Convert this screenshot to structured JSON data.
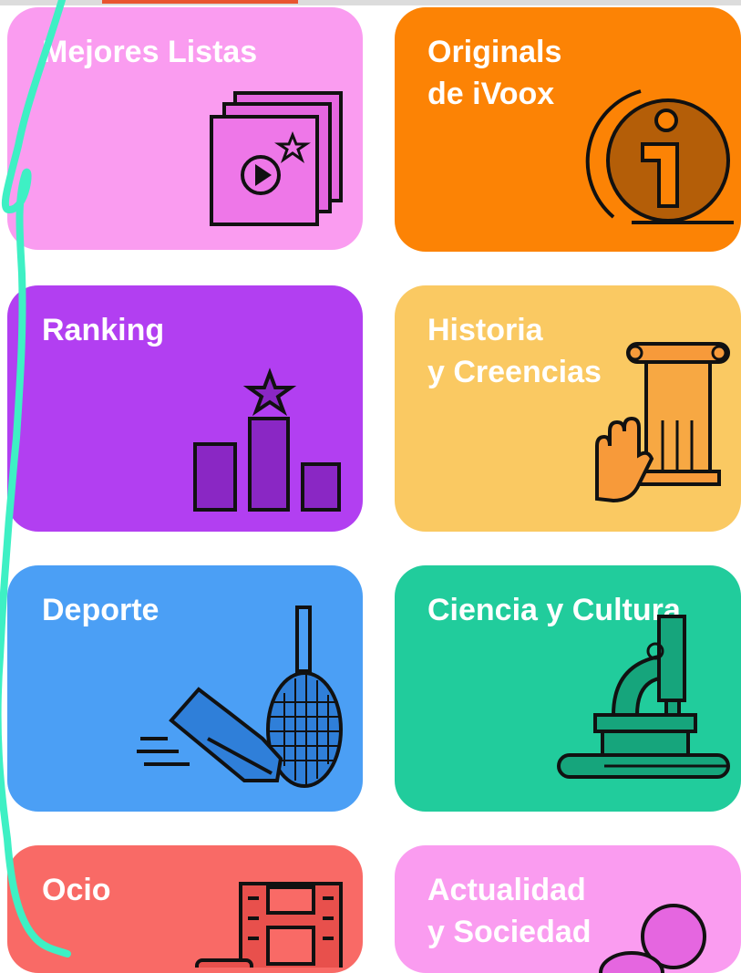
{
  "categories": [
    {
      "label": "Mejores Listas",
      "color": "#fa9cf0",
      "icon": "playlist-icon"
    },
    {
      "label": "Originals\nde iVoox",
      "color": "#fc8305",
      "icon": "ivoox-logo-icon"
    },
    {
      "label": "Ranking",
      "color": "#b23ff1",
      "icon": "podium-icon"
    },
    {
      "label": "Historia\ny Creencias",
      "color": "#fac962",
      "icon": "column-hand-icon"
    },
    {
      "label": "Deporte",
      "color": "#4b9ff5",
      "icon": "shoe-racket-icon"
    },
    {
      "label": "Ciencia y Cultura",
      "color": "#21cc9c",
      "icon": "microscope-icon"
    },
    {
      "label": "Ocio",
      "color": "#f96a66",
      "icon": "film-strip-icon"
    },
    {
      "label": "Actualidad\ny Sociedad",
      "color": "#fa9cf0",
      "icon": "speech-bubble-icon"
    }
  ],
  "doodle_color": "#3ef0c4"
}
